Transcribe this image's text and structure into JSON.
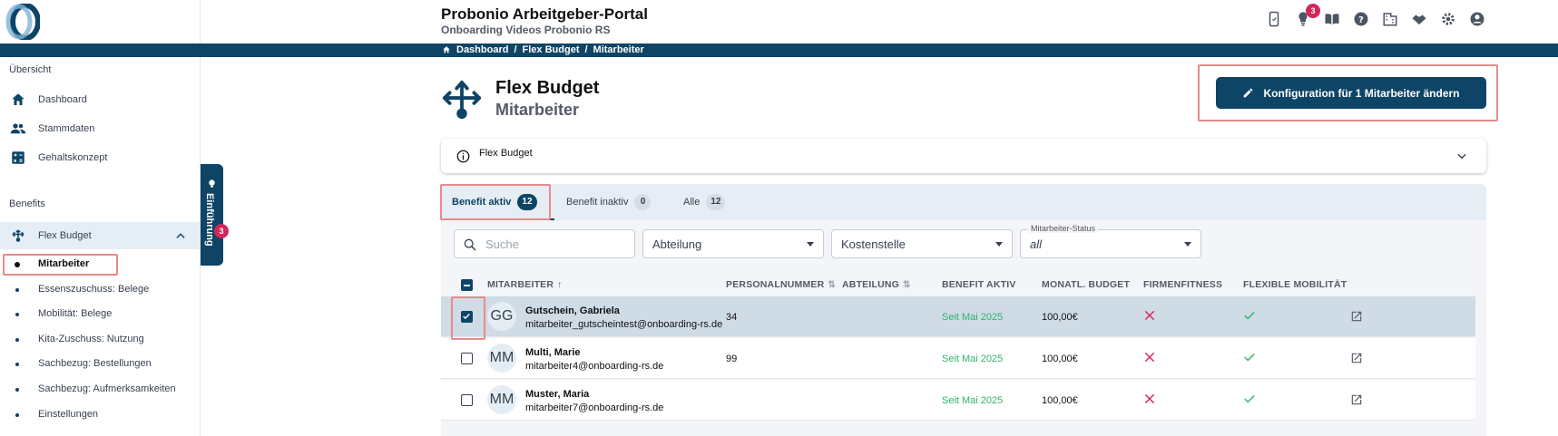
{
  "header": {
    "title": "Probonio Arbeitgeber-Portal",
    "subtitle": "Onboarding Videos Probonio RS",
    "notification_count": "3",
    "icons": [
      "phone-icon",
      "lightbulb-icon",
      "book-icon",
      "help-icon",
      "building-icon",
      "handshake-icon",
      "gear-icon",
      "account-icon"
    ]
  },
  "breadcrumb": {
    "items": [
      "Dashboard",
      "Flex Budget",
      "Mitarbeiter"
    ]
  },
  "sidebar": {
    "section_overview": "Übersicht",
    "overview_items": [
      {
        "label": "Dashboard",
        "icon": "home-icon"
      },
      {
        "label": "Stammdaten",
        "icon": "people-icon"
      },
      {
        "label": "Gehaltskonzept",
        "icon": "calculator-icon"
      }
    ],
    "section_benefits": "Benefits",
    "flex_budget": "Flex Budget",
    "sub_items": [
      "Mitarbeiter",
      "Essenszuschuss: Belege",
      "Mobilität: Belege",
      "Kita-Zuschuss: Nutzung",
      "Sachbezug: Bestellungen",
      "Sachbezug: Aufmerksamkeiten",
      "Einstellungen"
    ]
  },
  "intro_tab": {
    "label": "Einführung",
    "badge": "3"
  },
  "page": {
    "title": "Flex Budget",
    "subtitle": "Mitarbeiter",
    "config_button": "Konfiguration für 1 Mitarbeiter ändern",
    "info_label": "Flex Budget"
  },
  "tabs": [
    {
      "label": "Benefit aktiv",
      "count": "12"
    },
    {
      "label": "Benefit inaktiv",
      "count": "0"
    },
    {
      "label": "Alle",
      "count": "12"
    }
  ],
  "filters": {
    "search_placeholder": "Suche",
    "department": "Abteilung",
    "cost_center": "Kostenstelle",
    "status_label": "Mitarbeiter-Status",
    "status_value": "all"
  },
  "table": {
    "columns": [
      "MITARBEITER",
      "PERSONALNUMMER",
      "ABTEILUNG",
      "BENEFIT AKTIV",
      "MONATL. BUDGET",
      "FIRMENFITNESS",
      "FLEXIBLE MOBILITÄT"
    ],
    "rows": [
      {
        "initials": "GG",
        "name": "Gutschein, Gabriela",
        "email": "mitarbeiter_gutscheintest@onboarding-rs.de",
        "personalnummer": "34",
        "abteilung": "",
        "benefit_aktiv": "Seit Mai 2025",
        "budget": "100,00€",
        "firmenfitness": false,
        "mobilitaet": true,
        "selected": true
      },
      {
        "initials": "MM",
        "name": "Multi, Marie",
        "email": "mitarbeiter4@onboarding-rs.de",
        "personalnummer": "99",
        "abteilung": "",
        "benefit_aktiv": "Seit Mai 2025",
        "budget": "100,00€",
        "firmenfitness": false,
        "mobilitaet": true,
        "selected": false
      },
      {
        "initials": "MM",
        "name": "Muster, Maria",
        "email": "mitarbeiter7@onboarding-rs.de",
        "personalnummer": "",
        "abteilung": "",
        "benefit_aktiv": "Seit Mai 2025",
        "budget": "100,00€",
        "firmenfitness": false,
        "mobilitaet": true,
        "selected": false
      }
    ]
  },
  "colors": {
    "brand": "#0e4466",
    "active_green": "#2fb36d",
    "cross_red": "#d3265a",
    "highlight": "#e88a8a"
  }
}
